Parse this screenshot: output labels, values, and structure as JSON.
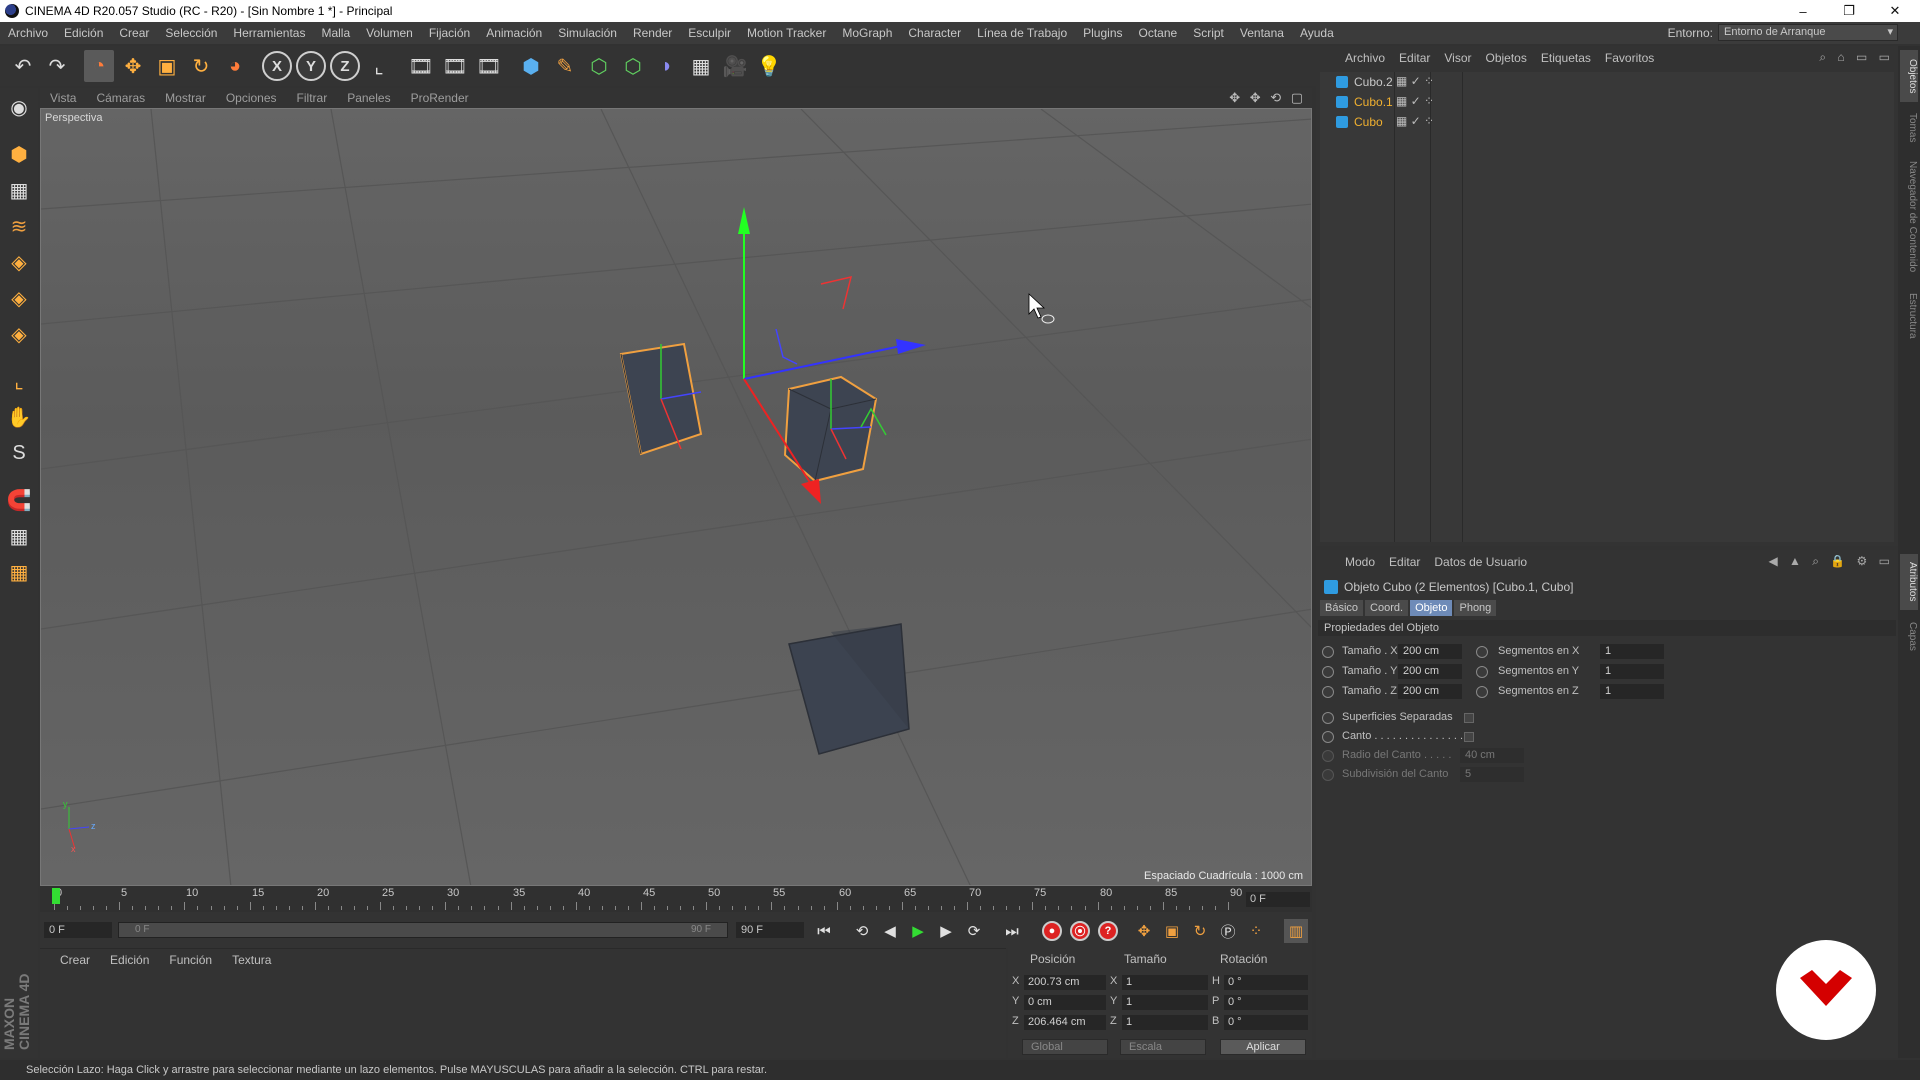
{
  "window": {
    "title": "CINEMA 4D R20.057 Studio (RC - R20) - [Sin Nombre 1 *] - Principal",
    "minimize": "–",
    "maximize": "❐",
    "close": "✕"
  },
  "menubar": {
    "items": [
      "Archivo",
      "Edición",
      "Crear",
      "Selección",
      "Herramientas",
      "Malla",
      "Volumen",
      "Fijación",
      "Animación",
      "Simulación",
      "Render",
      "Esculpir",
      "Motion Tracker",
      "MoGraph",
      "Character",
      "Línea de Trabajo",
      "Plugins",
      "Octane",
      "Script",
      "Ventana",
      "Ayuda"
    ],
    "environment_label": "Entorno:",
    "environment_value": "Entorno de Arranque"
  },
  "toolbar": {
    "undo": "↶",
    "redo": "↷",
    "live_select": "◔",
    "move": "✥",
    "scale": "▣",
    "rotate": "↻",
    "recent": "◕",
    "x": "X",
    "y": "Y",
    "z": "Z",
    "coord": "⌞",
    "render_view": "🎞",
    "render_po": "🎞",
    "render_settings": "🎞",
    "cube": "⬢",
    "pen": "✎",
    "subdiv": "⬡",
    "cloner": "⬡",
    "deformer": "◗",
    "floor": "▦",
    "camera": "🎥",
    "light": "💡"
  },
  "lefttools": [
    "◉",
    "⬢",
    "▦",
    "≋",
    "◈",
    "◈",
    "◈",
    "⌞",
    "✋",
    "S",
    "🧲",
    "▦",
    "▦"
  ],
  "maxon_logo": "MAXON CINEMA 4D",
  "viewport": {
    "menu": [
      "Vista",
      "Cámaras",
      "Mostrar",
      "Opciones",
      "Filtrar",
      "Paneles",
      "ProRender"
    ],
    "icons": "✥ ✥ ⟲ ▢",
    "label": "Perspectiva",
    "grid_spacing": "Espaciado Cuadrícula : 1000 cm",
    "axis_y": "y",
    "axis_z": "z",
    "axis_x": "x"
  },
  "timeline": {
    "ticks": [
      "0",
      "5",
      "10",
      "15",
      "20",
      "25",
      "30",
      "35",
      "40",
      "45",
      "50",
      "55",
      "60",
      "65",
      "70",
      "75",
      "80",
      "85",
      "90"
    ],
    "frame_input": "0 F"
  },
  "playbar": {
    "start": "0 F",
    "slider_left": "0 F",
    "slider_right": "90 F",
    "end": "90 F",
    "first": "⏮",
    "prev_key": "⟲",
    "prev": "◀",
    "play": "▶",
    "next": "▶",
    "next_key": "⟳",
    "last": "⏭",
    "rec": "●",
    "autokey": "⦿",
    "keyframe": "?"
  },
  "material_manager": {
    "menu": [
      "Crear",
      "Edición",
      "Función",
      "Textura"
    ]
  },
  "coord_manager": {
    "headers": [
      "Posición",
      "Tamaño",
      "Rotación"
    ],
    "rows": [
      {
        "axis": "X",
        "pos": "200.73 cm",
        "size_axis": "X",
        "size": "1",
        "rot_axis": "H",
        "rot": "0 °"
      },
      {
        "axis": "Y",
        "pos": "0 cm",
        "size_axis": "Y",
        "size": "1",
        "rot_axis": "P",
        "rot": "0 °"
      },
      {
        "axis": "Z",
        "pos": "206.464 cm",
        "size_axis": "Z",
        "size": "1",
        "rot_axis": "B",
        "rot": "0 °"
      }
    ],
    "global": "Global",
    "scale": "Escala",
    "apply": "Aplicar"
  },
  "object_manager": {
    "menu": [
      "Archivo",
      "Editar",
      "Visor",
      "Objetos",
      "Etiquetas",
      "Favoritos"
    ],
    "icons": "⌕ ⌂ ▭ ▭",
    "objects": [
      {
        "name": "Cubo.2",
        "color": "#c8c8c8"
      },
      {
        "name": "Cubo.1",
        "color": "#f0b030"
      },
      {
        "name": "Cubo",
        "color": "#f0b030"
      }
    ],
    "tags": "▦ ✓ ⁘"
  },
  "attribute_manager": {
    "menu": [
      "Modo",
      "Editar",
      "Datos de Usuario"
    ],
    "icons": "◀ ▲ ⌕ 🔒 ⚙ ▭",
    "title": "Objeto Cubo  (2 Elementos) [Cubo.1, Cubo]",
    "tabs": [
      "Básico",
      "Coord.",
      "Objeto",
      "Phong"
    ],
    "active_tab": "Objeto",
    "section": "Propiedades del Objeto",
    "size_x_label": "Tamaño . X",
    "size_x": "200 cm",
    "size_y_label": "Tamaño . Y",
    "size_y": "200 cm",
    "size_z_label": "Tamaño . Z",
    "size_z": "200 cm",
    "seg_x_label": "Segmentos en X",
    "seg_x": "1",
    "seg_y_label": "Segmentos en Y",
    "seg_y": "1",
    "seg_z_label": "Segmentos en Z",
    "seg_z": "1",
    "separate_surfaces": "Superficies Separadas",
    "fillet": "Canto . . . . . . . . . . . . . . .",
    "fillet_radius_label": "Radio del Canto . . . . .",
    "fillet_radius": "40 cm",
    "fillet_subdiv_label": "Subdivisión del Canto",
    "fillet_subdiv": "5"
  },
  "vtabs": [
    "Objetos",
    "Tomas",
    "Navegador de Contenido",
    "Estructura",
    "Atributos",
    "Capas"
  ],
  "statusbar": "Selección Lazo: Haga Click y arrastre para seleccionar mediante un lazo elementos. Pulse MAYUSCULAS para añadir a la selección. CTRL para restar."
}
